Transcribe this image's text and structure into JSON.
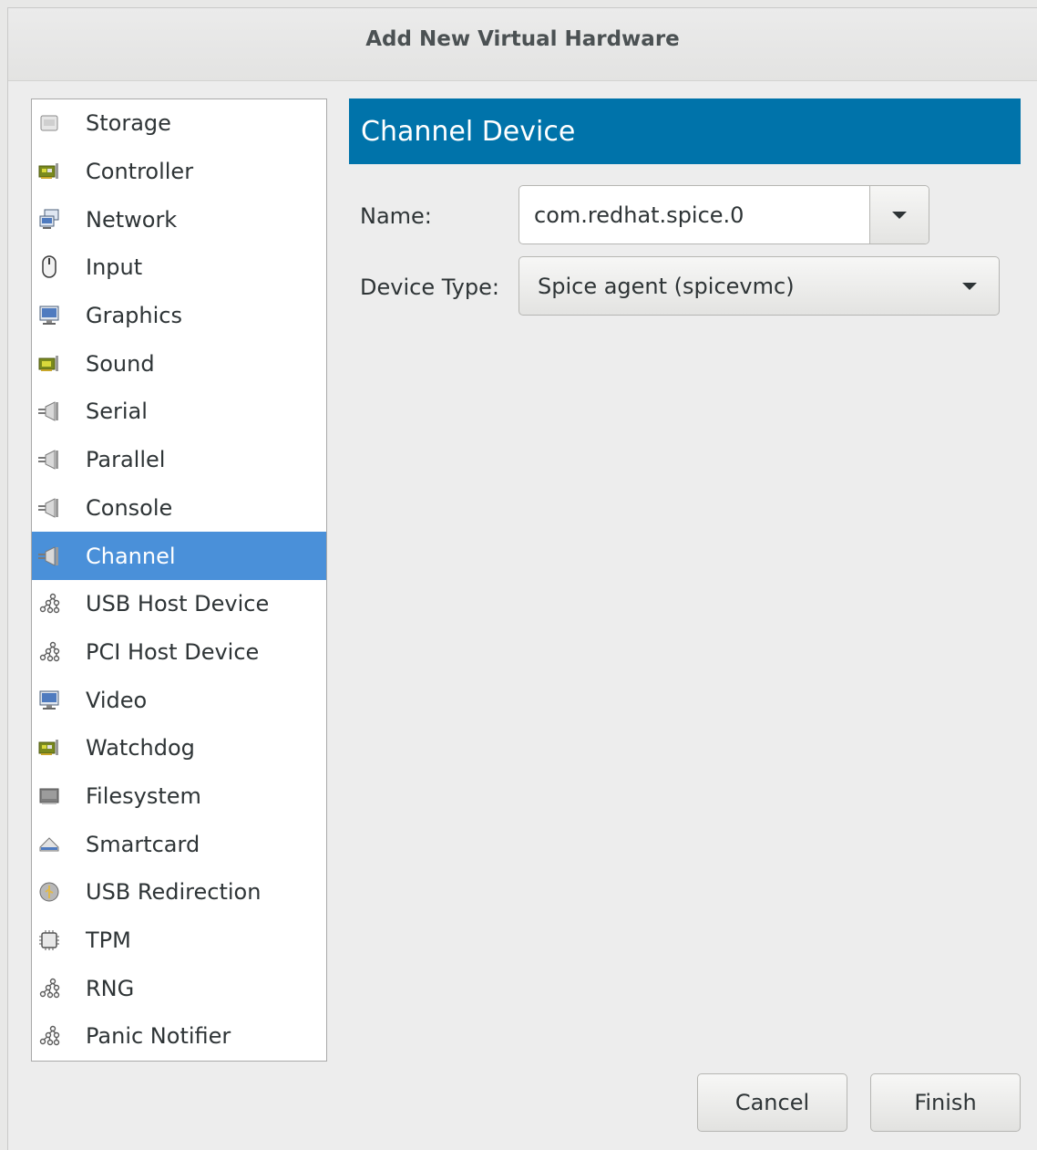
{
  "window": {
    "title": "Add New Virtual Hardware"
  },
  "sidebar": {
    "items": [
      {
        "label": "Storage",
        "icon": "storage-icon"
      },
      {
        "label": "Controller",
        "icon": "controller-card-icon"
      },
      {
        "label": "Network",
        "icon": "network-icon"
      },
      {
        "label": "Input",
        "icon": "mouse-icon"
      },
      {
        "label": "Graphics",
        "icon": "monitor-icon"
      },
      {
        "label": "Sound",
        "icon": "sound-card-icon"
      },
      {
        "label": "Serial",
        "icon": "plug-icon"
      },
      {
        "label": "Parallel",
        "icon": "plug-icon"
      },
      {
        "label": "Console",
        "icon": "plug-icon"
      },
      {
        "label": "Channel",
        "icon": "plug-icon",
        "selected": true
      },
      {
        "label": "USB Host Device",
        "icon": "device-tree-icon"
      },
      {
        "label": "PCI Host Device",
        "icon": "device-tree-icon"
      },
      {
        "label": "Video",
        "icon": "monitor-icon"
      },
      {
        "label": "Watchdog",
        "icon": "controller-card-icon"
      },
      {
        "label": "Filesystem",
        "icon": "filesystem-icon"
      },
      {
        "label": "Smartcard",
        "icon": "smartcard-icon"
      },
      {
        "label": "USB Redirection",
        "icon": "usb-icon"
      },
      {
        "label": "TPM",
        "icon": "chip-icon"
      },
      {
        "label": "RNG",
        "icon": "device-tree-icon"
      },
      {
        "label": "Panic Notifier",
        "icon": "device-tree-icon"
      }
    ]
  },
  "panel": {
    "header": "Channel Device",
    "name_label": "Name:",
    "name_value": "com.redhat.spice.0",
    "device_type_label": "Device Type:",
    "device_type_value": "Spice agent (spicevmc)"
  },
  "buttons": {
    "cancel": "Cancel",
    "finish": "Finish"
  },
  "colors": {
    "header_bg": "#0073aa",
    "selection": "#4a90d9"
  }
}
